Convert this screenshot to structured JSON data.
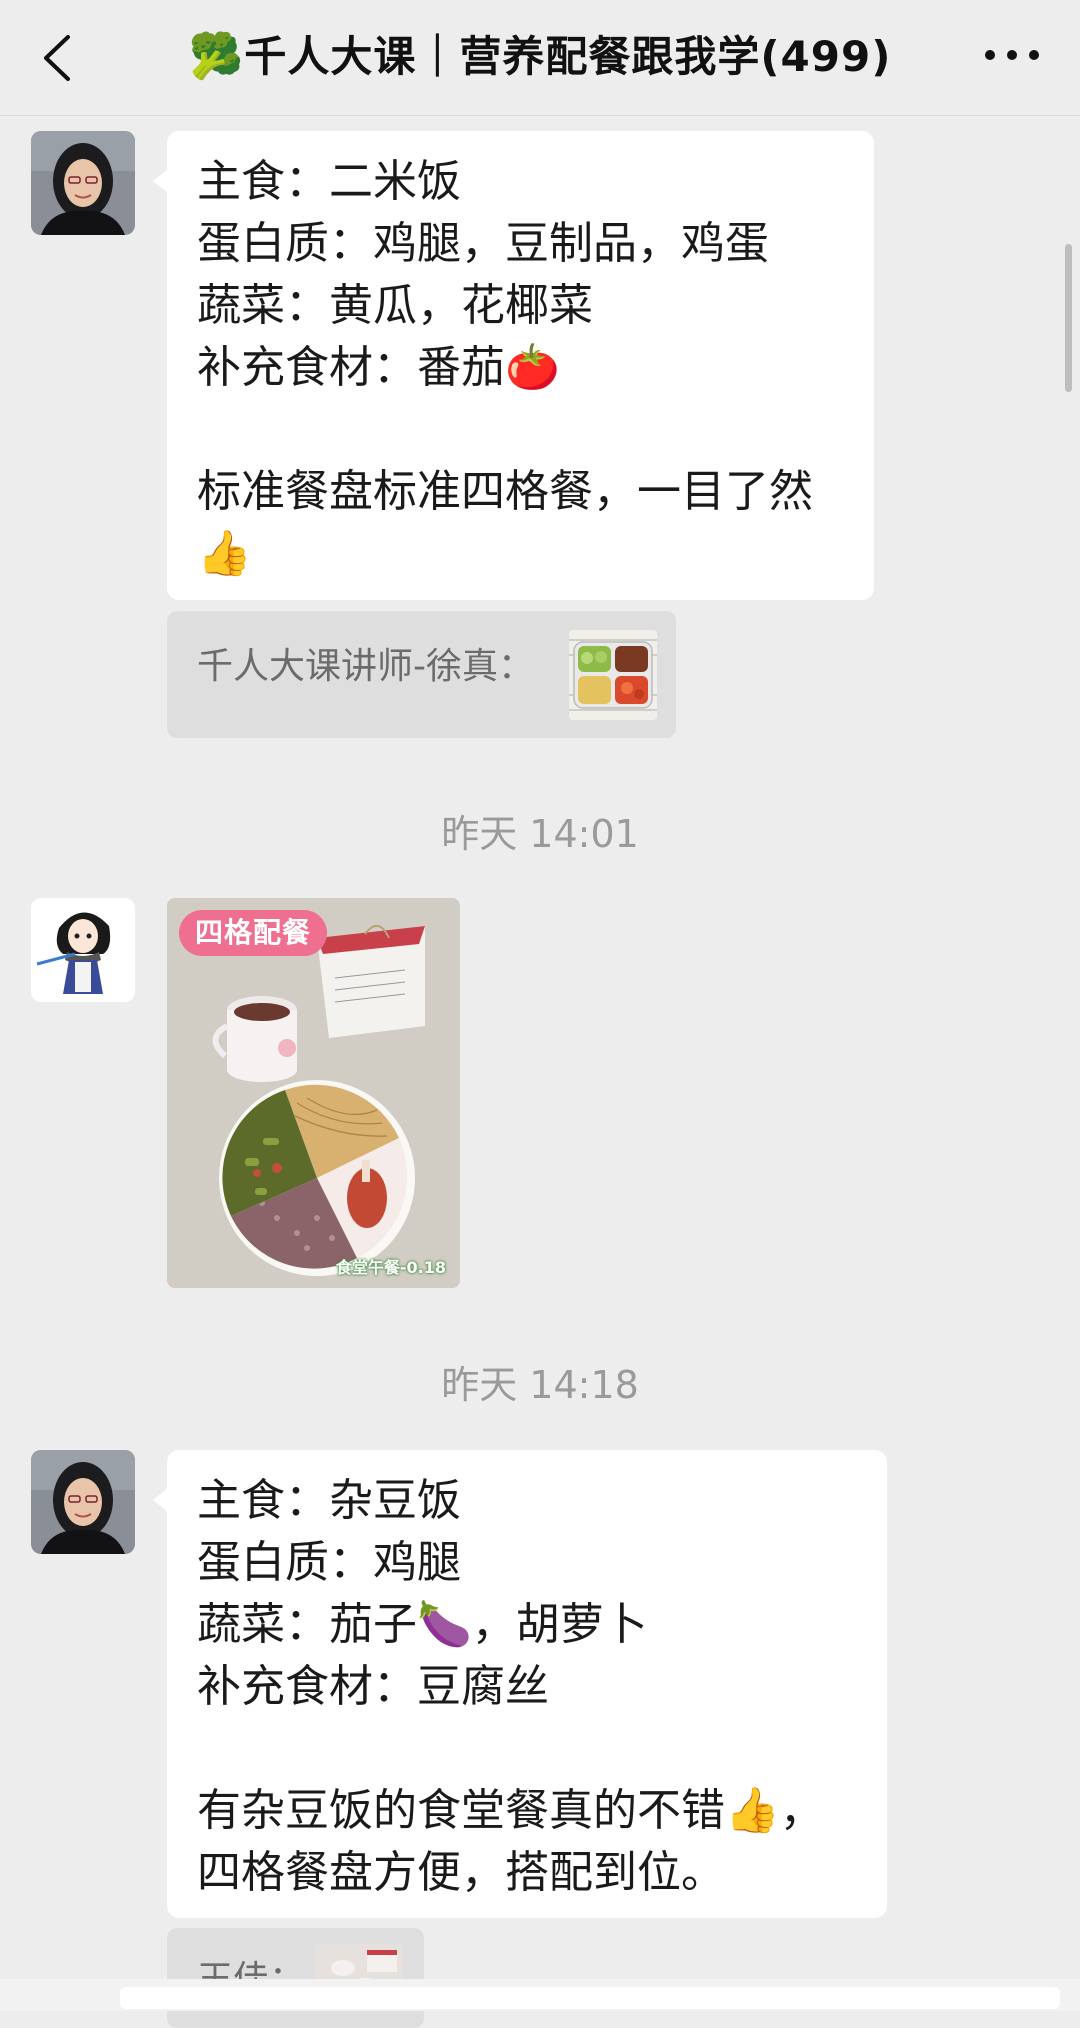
{
  "header": {
    "title_emoji": "🥦",
    "title": "千人大课｜营养配餐跟我学(499)",
    "back_icon": "chevron-left-icon",
    "more_icon": "more-dots-icon"
  },
  "messages": {
    "m1": {
      "lines": [
        "主食：二米饭",
        "蛋白质：鸡腿，豆制品，鸡蛋",
        "蔬菜：黄瓜，花椰菜",
        "补充食材：番茄🍅",
        "",
        "标准餐盘标准四格餐，一目了然",
        "👍"
      ]
    },
    "q1": {
      "text": "千人大课讲师-徐真："
    },
    "t1": "昨天 14:01",
    "photo": {
      "badge": "四格配餐",
      "caption": "食堂午餐-0.18"
    },
    "t2": "昨天 14:18",
    "m2": {
      "lines": [
        "主食：杂豆饭",
        "蛋白质：鸡腿",
        "蔬菜：茄子🍆，胡萝卜",
        "补充食材：豆腐丝",
        "",
        "有杂豆饭的食堂餐真的不错👍，",
        "四格餐盘方便，搭配到位。"
      ]
    },
    "q2": {
      "text": "王佳："
    }
  },
  "colors": {
    "background": "#ededed",
    "bubble": "#ffffff",
    "quote": "#dedede",
    "timestamp": "#9a9a9a"
  }
}
